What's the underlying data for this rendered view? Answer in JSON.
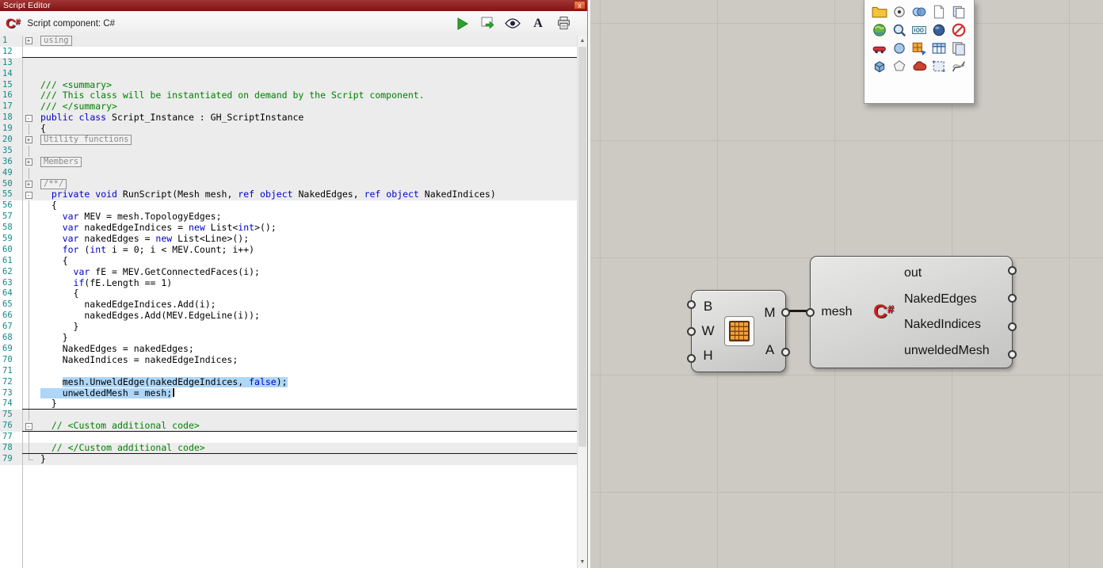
{
  "window": {
    "title": "Script Editor",
    "close_glyph": "x"
  },
  "toolbar": {
    "csharp_c": "C",
    "csharp_hash": "#",
    "label": "Script component: C#",
    "font_button": "A"
  },
  "scrollbar": {
    "up": "▲",
    "down": "▼"
  },
  "editor": {
    "lines": [
      {
        "n": 1,
        "bg": "g",
        "fold": "plus",
        "box": "using"
      },
      {
        "n": 12,
        "bg": "w",
        "sep": true
      },
      {
        "n": 13,
        "bg": "g"
      },
      {
        "n": 14,
        "bg": "g"
      },
      {
        "n": 15,
        "bg": "g",
        "toks": [
          [
            "/// <summary>",
            "c"
          ]
        ]
      },
      {
        "n": 16,
        "bg": "g",
        "toks": [
          [
            "/// This class will be instantiated on demand by the Script component.",
            "c"
          ]
        ]
      },
      {
        "n": 17,
        "bg": "g",
        "toks": [
          [
            "/// </summary>",
            "c"
          ]
        ]
      },
      {
        "n": 18,
        "bg": "g",
        "fold": "minus",
        "toks": [
          [
            "public",
            "k"
          ],
          [
            " ",
            "p"
          ],
          [
            "class",
            "k"
          ],
          [
            " Script_Instance : GH_ScriptInstance",
            "p"
          ]
        ]
      },
      {
        "n": 19,
        "bg": "g",
        "fold": "line",
        "toks": [
          [
            "{",
            "p"
          ]
        ]
      },
      {
        "n": 20,
        "bg": "g",
        "fold": "plus",
        "box": "Utility functions"
      },
      {
        "n": 35,
        "bg": "g",
        "fold": "line"
      },
      {
        "n": 36,
        "bg": "g",
        "fold": "plus",
        "box": "Members"
      },
      {
        "n": 49,
        "bg": "g",
        "fold": "line"
      },
      {
        "n": 50,
        "bg": "g",
        "fold": "plus",
        "box": "/**/"
      },
      {
        "n": 55,
        "bg": "g",
        "fold": "minus",
        "toks": [
          [
            "  ",
            "p"
          ],
          [
            "private",
            "k"
          ],
          [
            " ",
            "p"
          ],
          [
            "void",
            "k"
          ],
          [
            " RunScript(Mesh mesh, ",
            "p"
          ],
          [
            "ref",
            "k"
          ],
          [
            " ",
            "p"
          ],
          [
            "object",
            "k"
          ],
          [
            " NakedEdges, ",
            "p"
          ],
          [
            "ref",
            "k"
          ],
          [
            " ",
            "p"
          ],
          [
            "object",
            "k"
          ],
          [
            " NakedIndices)",
            "p"
          ]
        ]
      },
      {
        "n": 56,
        "bg": "w",
        "fold": "line",
        "toks": [
          [
            "  {",
            "p"
          ]
        ]
      },
      {
        "n": 57,
        "bg": "w",
        "fold": "line",
        "toks": [
          [
            "    ",
            "p"
          ],
          [
            "var",
            "k"
          ],
          [
            " MEV = mesh.TopologyEdges;",
            "p"
          ]
        ]
      },
      {
        "n": 58,
        "bg": "w",
        "fold": "line",
        "toks": [
          [
            "    ",
            "p"
          ],
          [
            "var",
            "k"
          ],
          [
            " nakedEdgeIndices = ",
            "p"
          ],
          [
            "new",
            "k"
          ],
          [
            " List<",
            "p"
          ],
          [
            "int",
            "k"
          ],
          [
            ">();",
            "p"
          ]
        ]
      },
      {
        "n": 59,
        "bg": "w",
        "fold": "line",
        "toks": [
          [
            "    ",
            "p"
          ],
          [
            "var",
            "k"
          ],
          [
            " nakedEdges = ",
            "p"
          ],
          [
            "new",
            "k"
          ],
          [
            " List<Line>();",
            "p"
          ]
        ]
      },
      {
        "n": 60,
        "bg": "w",
        "fold": "line",
        "toks": [
          [
            "    ",
            "p"
          ],
          [
            "for",
            "k"
          ],
          [
            " (",
            "p"
          ],
          [
            "int",
            "k"
          ],
          [
            " i = 0; i < MEV.Count; i++)",
            "p"
          ]
        ]
      },
      {
        "n": 61,
        "bg": "w",
        "fold": "line",
        "toks": [
          [
            "    {",
            "p"
          ]
        ]
      },
      {
        "n": 62,
        "bg": "w",
        "fold": "line",
        "toks": [
          [
            "      ",
            "p"
          ],
          [
            "var",
            "k"
          ],
          [
            " fE = MEV.GetConnectedFaces(i);",
            "p"
          ]
        ]
      },
      {
        "n": 63,
        "bg": "w",
        "fold": "line",
        "toks": [
          [
            "      ",
            "p"
          ],
          [
            "if",
            "k"
          ],
          [
            "(fE.Length == 1)",
            "p"
          ]
        ]
      },
      {
        "n": 64,
        "bg": "w",
        "fold": "line",
        "toks": [
          [
            "      {",
            "p"
          ]
        ]
      },
      {
        "n": 65,
        "bg": "w",
        "fold": "line",
        "toks": [
          [
            "        nakedEdgeIndices.Add(i);",
            "p"
          ]
        ]
      },
      {
        "n": 66,
        "bg": "w",
        "fold": "line",
        "toks": [
          [
            "        nakedEdges.Add(MEV.EdgeLine(i));",
            "p"
          ]
        ]
      },
      {
        "n": 67,
        "bg": "w",
        "fold": "line",
        "toks": [
          [
            "      }",
            "p"
          ]
        ]
      },
      {
        "n": 68,
        "bg": "w",
        "fold": "line",
        "toks": [
          [
            "    }",
            "p"
          ]
        ]
      },
      {
        "n": 69,
        "bg": "w",
        "fold": "line",
        "toks": [
          [
            "    NakedEdges = nakedEdges;",
            "p"
          ]
        ]
      },
      {
        "n": 70,
        "bg": "w",
        "fold": "line",
        "toks": [
          [
            "    NakedIndices = nakedEdgeIndices;",
            "p"
          ]
        ]
      },
      {
        "n": 71,
        "bg": "w",
        "fold": "line"
      },
      {
        "n": 72,
        "bg": "w",
        "fold": "line",
        "toks": [
          [
            "    ",
            "p"
          ],
          [
            "mesh.UnweldEdge(nakedEdgeIndices, ",
            "ps"
          ],
          [
            "false",
            "ks"
          ],
          [
            ");",
            "ps"
          ]
        ]
      },
      {
        "n": 73,
        "bg": "w",
        "fold": "line",
        "caret": true,
        "toks": [
          [
            "    unweldedMesh = mesh;",
            "ps"
          ]
        ]
      },
      {
        "n": 74,
        "bg": "w",
        "fold": "line",
        "sep": true,
        "toks": [
          [
            "  }",
            "p"
          ]
        ]
      },
      {
        "n": 75,
        "bg": "g",
        "fold": "line"
      },
      {
        "n": 76,
        "bg": "g",
        "fold": "minus",
        "sep": true,
        "toks": [
          [
            "  ",
            "p"
          ],
          [
            "// <Custom additional code>",
            "c"
          ]
        ]
      },
      {
        "n": 77,
        "bg": "w",
        "fold": "line"
      },
      {
        "n": 78,
        "bg": "g",
        "fold": "line",
        "sep": true,
        "toks": [
          [
            "  ",
            "p"
          ],
          [
            "// </Custom additional code>",
            "c"
          ]
        ]
      },
      {
        "n": 79,
        "bg": "g",
        "fold": "end",
        "toks": [
          [
            "}",
            "p"
          ]
        ]
      }
    ]
  },
  "palette": {
    "icons": [
      "folder-icon",
      "point-icon",
      "geometry-icon",
      "document-icon",
      "documents-icon",
      "earth-icon",
      "zoom-icon",
      "counter-icon",
      "sphere-icon",
      "disable-icon",
      "vehicle-icon",
      "circle-icon",
      "mesh-face-icon",
      "table-icon",
      "layers-icon",
      "box-icon",
      "polygon-icon",
      "cloud-icon",
      "region-icon",
      "curves-icon"
    ]
  },
  "canvas": {
    "box_component": {
      "inputs": [
        "B",
        "W",
        "H"
      ],
      "outputs": [
        "M",
        "A"
      ]
    },
    "script_component": {
      "input": "mesh",
      "badge_c": "C",
      "badge_hash": "#",
      "outputs": [
        "out",
        "NakedEdges",
        "NakedIndices",
        "unweldedMesh"
      ]
    }
  },
  "colors": {
    "keyword": "#0000cc",
    "comment": "#008000",
    "line_number": "#118888",
    "selection": "#aed6f7",
    "titlebar": "#8e1f1f",
    "close_button": "#e0542e",
    "play": "#2da12d",
    "canvas_bg": "#cdc9c3",
    "grid_line": "#bfbcb6",
    "mesh_icon": "#f2a03a",
    "csharp_red": "#cf2020"
  }
}
